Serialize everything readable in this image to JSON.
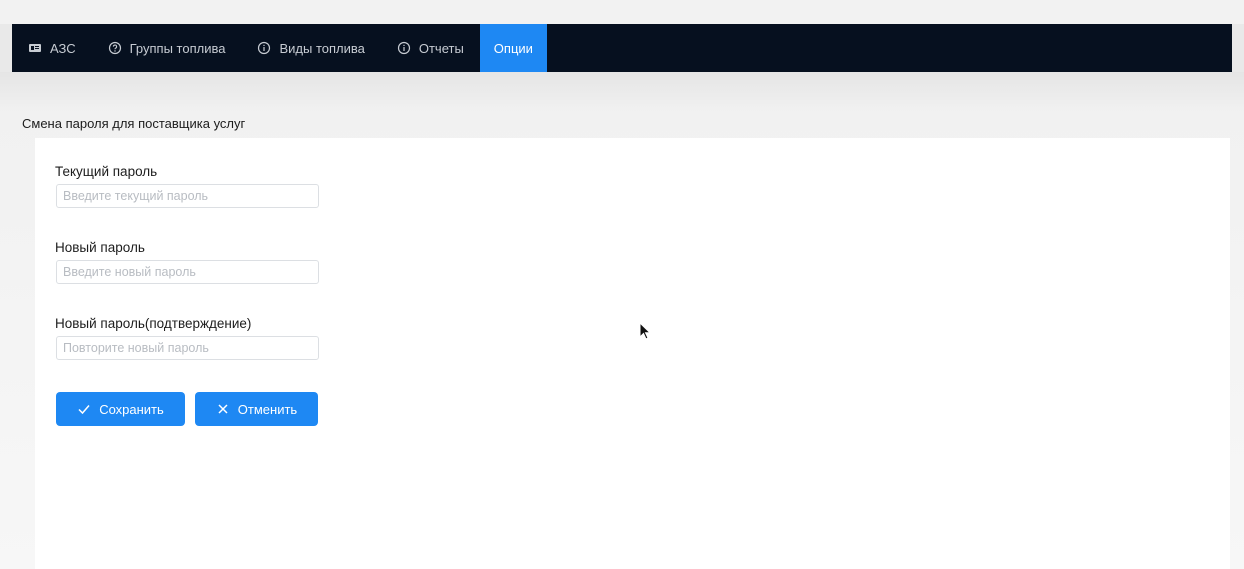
{
  "nav": {
    "items": [
      {
        "label": "АЗС",
        "icon": "station-card-icon"
      },
      {
        "label": "Группы топлива",
        "icon": "help-circle-icon"
      },
      {
        "label": "Виды топлива",
        "icon": "info-circle-icon"
      },
      {
        "label": "Отчеты",
        "icon": "info-circle-icon"
      }
    ],
    "active_label": "Опции"
  },
  "page": {
    "title": "Смена пароля для поставщика услуг"
  },
  "form": {
    "current": {
      "label": "Текущий пароль",
      "placeholder": "Введите текущий пароль",
      "value": ""
    },
    "new": {
      "label": "Новый пароль",
      "placeholder": "Введите новый пароль",
      "value": ""
    },
    "confirm": {
      "label": "Новый пароль(подтверждение)",
      "placeholder": "Повторите новый пароль",
      "value": ""
    }
  },
  "buttons": {
    "save_label": "Сохранить",
    "save_icon": "check-icon",
    "cancel_label": "Отменить",
    "cancel_icon": "close-icon"
  },
  "colors": {
    "navbar_bg": "#06101f",
    "accent": "#1e88f3",
    "nav_text": "#c7ccd3"
  }
}
